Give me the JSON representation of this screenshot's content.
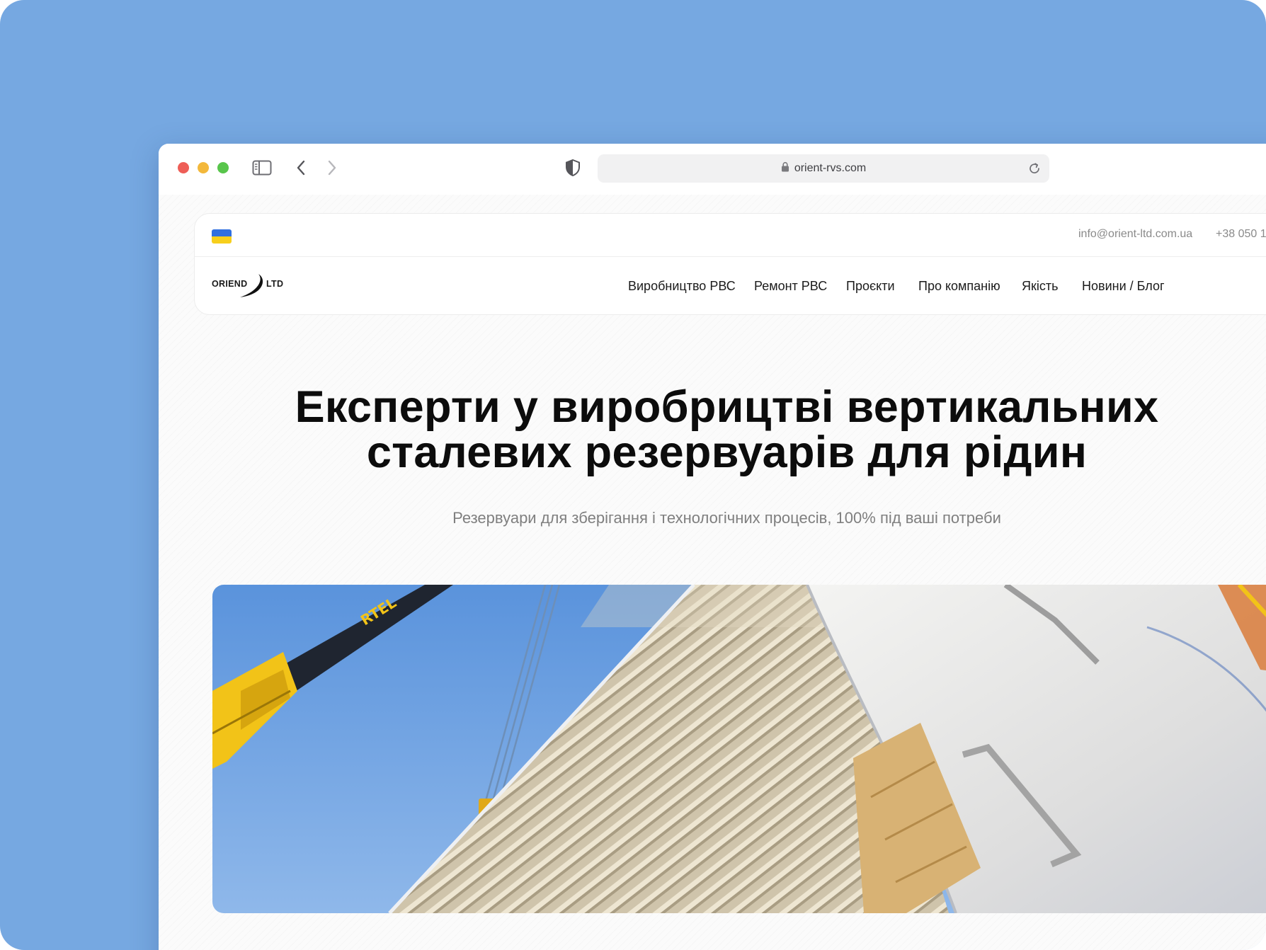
{
  "browser": {
    "url": "orient-rvs.com"
  },
  "header": {
    "contact_email": "info@orient-ltd.com.ua",
    "contact_phone": "+38 050 1",
    "logo_left": "ORIEND",
    "logo_right": "LTD",
    "nav": [
      "Виробництво РВС",
      "Ремонт РВС",
      "Проєкти",
      "Про компанію",
      "Якість",
      "Новини / Блог"
    ]
  },
  "hero": {
    "title_line1": "Експерти у виробрицтві вертикальних",
    "title_line2": "сталевих резервуарів для рідин",
    "subtitle": "Резервуари для зберігання і технологічних процесів, 100% під ваші потреби",
    "crane_text": "RTEL"
  },
  "colors": {
    "backdrop": "#76a8e1",
    "flag_blue": "#2f6fe0",
    "flag_yellow": "#f7cf1c",
    "crane_yellow": "#f2c318",
    "sky": "#5d97dd"
  }
}
